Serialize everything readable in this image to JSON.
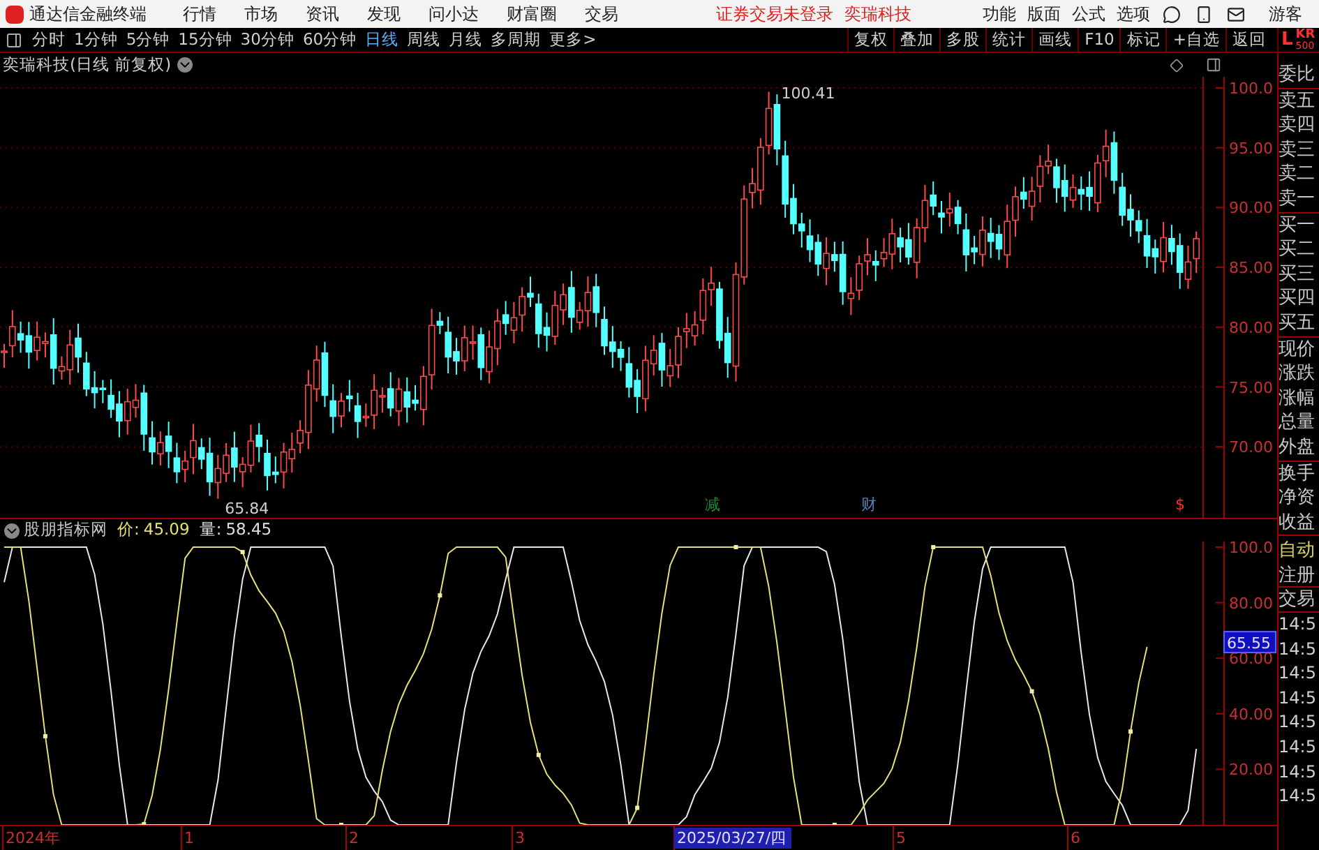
{
  "app_bar": {
    "title": "通达信金融终端",
    "menu": [
      "行情",
      "市场",
      "资讯",
      "发现",
      "问小达",
      "财富圈",
      "交易"
    ],
    "notice": "证券交易未登录",
    "stock": "奕瑞科技",
    "tools": [
      "功能",
      "版面",
      "公式",
      "选项"
    ],
    "user": "游客"
  },
  "period_tabs": [
    {
      "label": "分时",
      "selected": false
    },
    {
      "label": "1分钟",
      "selected": false
    },
    {
      "label": "5分钟",
      "selected": false
    },
    {
      "label": "15分钟",
      "selected": false
    },
    {
      "label": "30分钟",
      "selected": false
    },
    {
      "label": "60分钟",
      "selected": false
    },
    {
      "label": "日线",
      "selected": true
    },
    {
      "label": "周线",
      "selected": false
    },
    {
      "label": "月线",
      "selected": false
    },
    {
      "label": "多周期",
      "selected": false
    },
    {
      "label": "更多>",
      "selected": false
    }
  ],
  "tools": [
    "复权",
    "叠加",
    "多股",
    "统计",
    "画线",
    "F10",
    "标记",
    "+自选",
    "返回"
  ],
  "corner": {
    "letter": "L",
    "code": "KR",
    "sub": "500"
  },
  "price_chart": {
    "title": "奕瑞科技(日线 前复权)",
    "yticks": [
      "100.0",
      "95.00",
      "90.00",
      "85.00",
      "80.00",
      "75.00",
      "70.00"
    ],
    "high_label": "100.41",
    "low_label": "65.84",
    "markers": [
      {
        "label": "减",
        "color": "#1f8a2e"
      },
      {
        "label": "财",
        "color": "#5a7fb0"
      },
      {
        "label": "$",
        "color": "#ff3030"
      }
    ]
  },
  "indicator": {
    "name": "股朋指标网",
    "price_label": "价:",
    "price": "45.09",
    "volume_label": "量:",
    "volume": "58.45",
    "yticks": [
      "100.0",
      "80.00",
      "60.00",
      "40.00",
      "20.00"
    ],
    "cursor_value": "65.55"
  },
  "x_axis": [
    {
      "label": "2024年",
      "selected": false
    },
    {
      "label": "1",
      "selected": false
    },
    {
      "label": "2",
      "selected": false
    },
    {
      "label": "3",
      "selected": false
    },
    {
      "label": "2025/03/27/四",
      "selected": true
    },
    {
      "label": "5",
      "selected": false
    },
    {
      "label": "6",
      "selected": false
    }
  ],
  "quote_panel": {
    "groups": [
      [
        "委比"
      ],
      [
        "卖五",
        "卖四",
        "卖三",
        "卖二",
        "卖一"
      ],
      [
        "买一",
        "买二",
        "买三",
        "买四",
        "买五"
      ],
      [
        "现价",
        "涨跌",
        "涨幅",
        "总量",
        "外盘"
      ],
      [
        "换手",
        "净资",
        "收益"
      ]
    ],
    "status": "自动",
    "actions": [
      "注册",
      "交易"
    ],
    "times": [
      "14:5",
      "14:5",
      "14:5",
      "14:5",
      "14:5",
      "14:5",
      "14:5",
      "14:5"
    ]
  }
}
